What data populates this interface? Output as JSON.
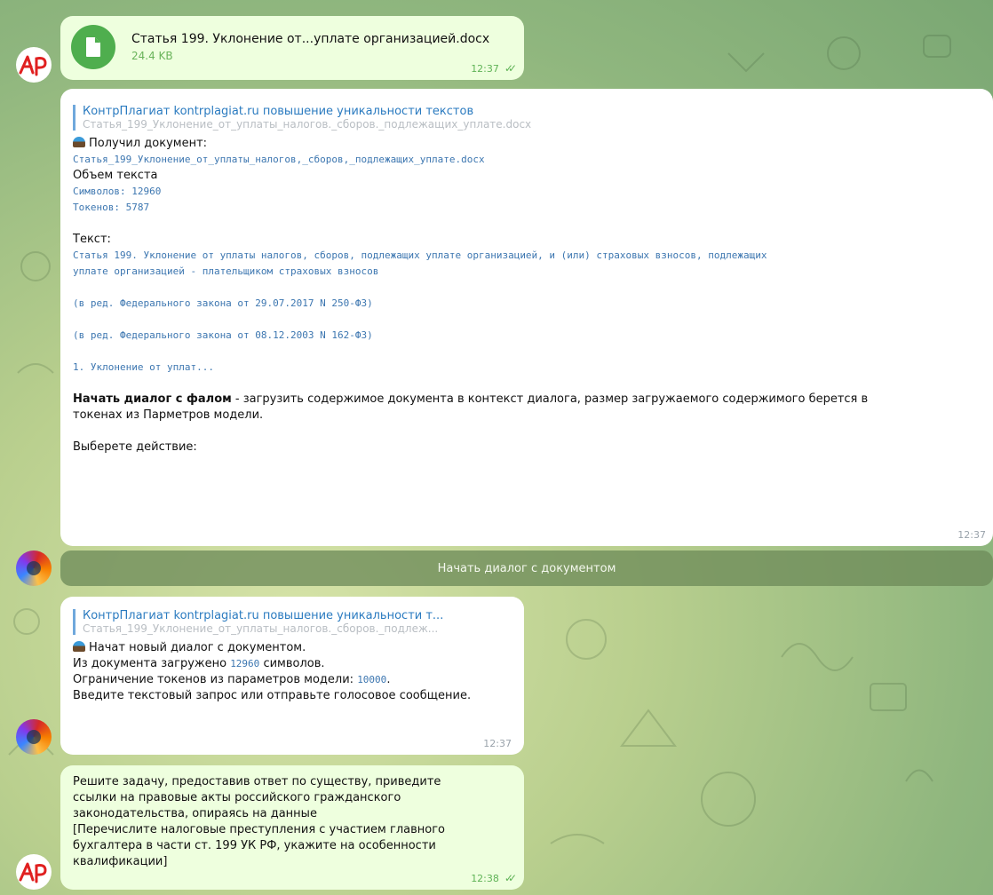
{
  "file_message": {
    "filename": "Статья 199. Уклонение от...уплате организацией.docx",
    "size": "24.4 KB",
    "time": "12:37"
  },
  "bot_message_1": {
    "reply_title": "КонтрПлагиат kontrplagiat.ru повышение уникальности текстов",
    "reply_subtitle": "Статья_199_Уклонение_от_уплаты_налогов._сборов._подлежащих_уплате.docx",
    "received_label": "Получил документ:",
    "doc_name": "Статья_199_Уклонение_от_уплаты_налогов,_сборов,_подлежащих_уплате.docx",
    "volume_label": "Объем текста",
    "chars": "Символов: 12960",
    "tokens": "Токенов: 5787",
    "text_label": "Текст:",
    "text_line1": "Статья 199. Уклонение от уплаты налогов, сборов, подлежащих уплате организацией, и (или) страховых взносов, подлежащих",
    "text_line2": "уплате организацией - плательщиком страховых взносов",
    "text_line3": "(в ред. Федерального закона от 29.07.2017 N 250-ФЗ)",
    "text_line4": "(в ред. Федерального закона от 08.12.2003 N 162-ФЗ)",
    "text_line5": "1. Уклонение от уплат...",
    "start_bold": "Начать диалог с фалом",
    "start_rest_1": " - загрузить содержимое документа в контекст диалога, размер загружаемого содержимого берется в",
    "start_rest_2": "токенах из Парметров модели.",
    "choose": "Выберете действие:",
    "time": "12:37"
  },
  "inline_button": {
    "label": "Начать диалог с документом"
  },
  "bot_message_2": {
    "reply_title": "КонтрПлагиат kontrplagiat.ru повышение уникальности т...",
    "reply_subtitle": "Статья_199_Уклонение_от_уплаты_налогов._сборов._подлеж...",
    "line1": "Начат новый диалог с документом.",
    "line2_a": "Из документа загружено ",
    "line2_num": "12960",
    "line2_b": " символов.",
    "line3_a": "Ограничение токенов из параметров модели: ",
    "line3_num": "10000",
    "line3_b": ".",
    "line4": "Введите текстовый запрос или отправьте голосовое сообщение.",
    "time": "12:37"
  },
  "user_message": {
    "lines": [
      "Решите задачу, предоставив ответ по существу, приведите",
      "ссылки на правовые акты российского гражданского",
      "законодательства, опираясь на данные",
      "[Перечислите налоговые преступления с участием главного",
      "бухгалтера в части ст. 199 УК РФ, укажите на особенности",
      "квалификации]"
    ],
    "time": "12:38"
  },
  "avatars": {
    "user": "Ap",
    "bot": "swirl"
  }
}
